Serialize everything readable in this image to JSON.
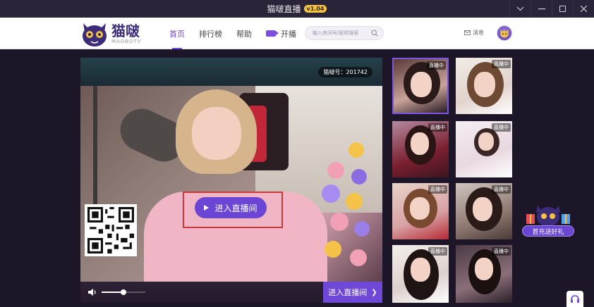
{
  "window": {
    "title": "猫啵直播",
    "version": "v1.04",
    "controls": [
      "chevron-down",
      "minimize",
      "maximize",
      "close"
    ]
  },
  "header": {
    "logo_cn": "猫啵",
    "logo_en": "MAOBOTV",
    "nav": [
      {
        "label": "首页",
        "active": true
      },
      {
        "label": "排行榜",
        "active": false
      },
      {
        "label": "帮助",
        "active": false
      },
      {
        "label": "开播",
        "active": false,
        "icon": "camera-icon"
      }
    ],
    "search_placeholder": "输入房间号/昵称搜索",
    "message_label": "消息"
  },
  "player": {
    "room_label": "猫啵号：201742",
    "enter_button": "进入直播间",
    "enter_bar": "进入直播间",
    "volume": 0.5
  },
  "thumbnails": [
    {
      "badge": "直播中",
      "selected": true
    },
    {
      "badge": "直播中",
      "selected": false
    },
    {
      "badge": "直播中",
      "selected": false
    },
    {
      "badge": "直播中",
      "selected": false
    },
    {
      "badge": "直播中",
      "selected": false
    },
    {
      "badge": "直播中",
      "selected": false
    },
    {
      "badge": "直播中",
      "selected": false
    },
    {
      "badge": "直播中",
      "selected": false
    }
  ],
  "promo": {
    "label": "首充送好礼"
  },
  "colors": {
    "accent": "#6d45d6",
    "background": "#1c1628",
    "highlight_border": "#c83a3a"
  }
}
